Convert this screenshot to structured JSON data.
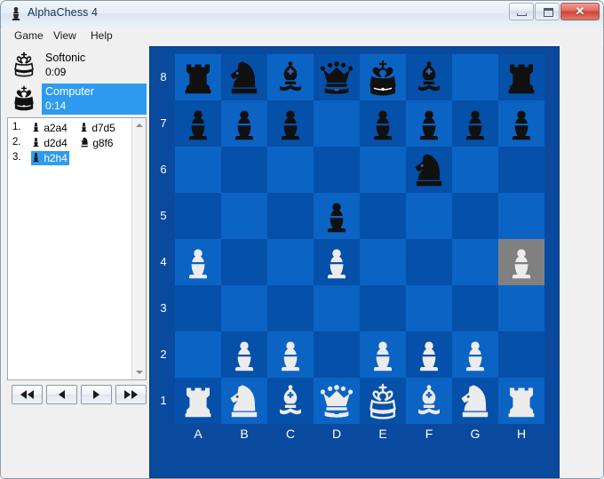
{
  "window": {
    "title": "AlphaChess 4",
    "icon": "chess-pawn-icon",
    "minimize_label": "–",
    "maximize_label": "□",
    "close_label": "✕"
  },
  "menu": {
    "items": [
      {
        "label": "Game",
        "accel": "G"
      },
      {
        "label": "View",
        "accel": "V"
      },
      {
        "label": "Help",
        "accel": "H"
      }
    ]
  },
  "players": [
    {
      "name": "Softonic",
      "time": "0:09",
      "side": "white",
      "active": false,
      "icon": "white-king-icon"
    },
    {
      "name": "Computer",
      "time": "0:14",
      "side": "black",
      "active": true,
      "icon": "black-king-icon"
    }
  ],
  "movelist": {
    "rows": [
      {
        "number": "1.",
        "white": {
          "text": "a2a4",
          "piece": "pawn",
          "selected": false
        },
        "black": {
          "text": "d7d5",
          "piece": "pawn",
          "selected": false
        }
      },
      {
        "number": "2.",
        "white": {
          "text": "d2d4",
          "piece": "pawn",
          "selected": false
        },
        "black": {
          "text": "g8f6",
          "piece": "knight",
          "selected": false
        }
      },
      {
        "number": "3.",
        "white": {
          "text": "h2h4",
          "piece": "pawn",
          "selected": true
        },
        "black": {
          "text": "",
          "piece": "",
          "selected": false
        }
      }
    ],
    "scroll_up_icon": "scroll-up-arrow-icon",
    "scroll_down_icon": "scroll-down-arrow-icon"
  },
  "navigation": {
    "buttons": [
      {
        "name": "first-move-button",
        "icon": "skip-back-icon"
      },
      {
        "name": "previous-move-button",
        "icon": "step-back-icon"
      },
      {
        "name": "next-move-button",
        "icon": "step-forward-icon"
      },
      {
        "name": "last-move-button",
        "icon": "skip-forward-icon"
      }
    ]
  },
  "board": {
    "files": [
      "A",
      "B",
      "C",
      "D",
      "E",
      "F",
      "G",
      "H"
    ],
    "ranks": [
      "8",
      "7",
      "6",
      "5",
      "4",
      "3",
      "2",
      "1"
    ],
    "colors": {
      "light_square": "#0b63c4",
      "dark_square": "#0550a8",
      "highlight_square": "#808080",
      "border": "#0a4a9e",
      "white_piece": "#ececec",
      "black_piece": "#101010"
    },
    "highlighted_squares": [
      "h4"
    ],
    "position": {
      "8": [
        "r",
        "n",
        "b",
        "q",
        "k",
        "b",
        "",
        "r"
      ],
      "7": [
        "p",
        "p",
        "p",
        "",
        "p",
        "p",
        "p",
        "p"
      ],
      "6": [
        "",
        "",
        "",
        "",
        "",
        "n",
        "",
        ""
      ],
      "5": [
        "",
        "",
        "",
        "p",
        "",
        "",
        "",
        ""
      ],
      "4": [
        "P",
        "",
        "",
        "P",
        "",
        "",
        "",
        "P"
      ],
      "3": [
        "",
        "",
        "",
        "",
        "",
        "",
        "",
        ""
      ],
      "2": [
        "",
        "P",
        "P",
        "",
        "P",
        "P",
        "P",
        ""
      ],
      "1": [
        "R",
        "N",
        "B",
        "Q",
        "K",
        "B",
        "N",
        "R"
      ]
    }
  }
}
